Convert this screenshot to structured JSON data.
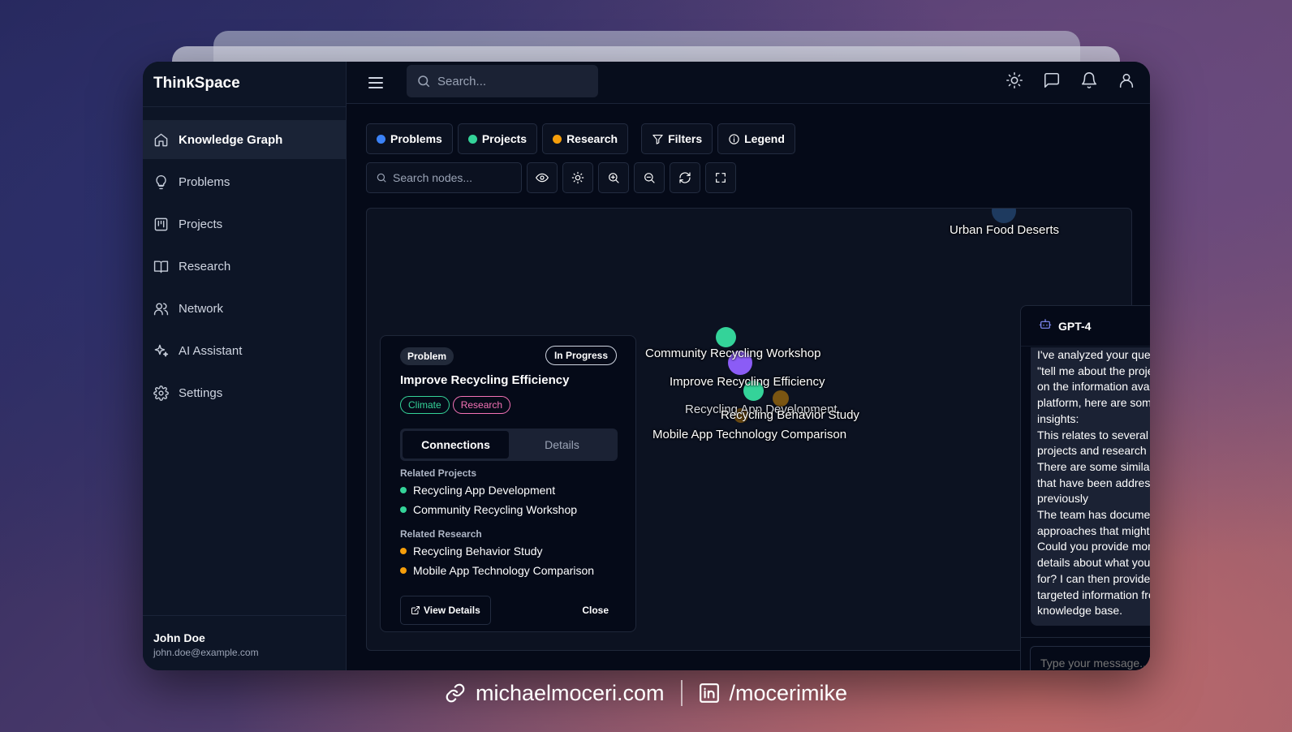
{
  "app": {
    "brand": "ThinkSpace"
  },
  "sidebar": {
    "items": [
      {
        "label": "Knowledge Graph",
        "icon": "home-icon",
        "active": true
      },
      {
        "label": "Problems",
        "icon": "lightbulb-icon"
      },
      {
        "label": "Projects",
        "icon": "project-chart-icon"
      },
      {
        "label": "Research",
        "icon": "book-open-icon"
      },
      {
        "label": "Network",
        "icon": "users-icon"
      },
      {
        "label": "AI Assistant",
        "icon": "sparkles-icon"
      },
      {
        "label": "Settings",
        "icon": "gear-icon"
      }
    ],
    "user": {
      "name": "John Doe",
      "email": "john.doe@example.com"
    }
  },
  "header": {
    "search_placeholder": "Search...",
    "icons": [
      "sun-icon",
      "message-icon",
      "bell-icon",
      "user-icon"
    ]
  },
  "filters": {
    "problems": "Problems",
    "projects": "Projects",
    "research": "Research",
    "filters": "Filters",
    "legend": "Legend"
  },
  "colors": {
    "problems": "#3b82f6",
    "projects": "#34d399",
    "research": "#f59e0b",
    "problem_node": "#8b5cf6",
    "accent": "#818cf8"
  },
  "toolbar": {
    "node_search_placeholder": "Search nodes...",
    "tools": [
      "eye-icon",
      "sun-icon",
      "zoom-in-icon",
      "zoom-out-icon",
      "refresh-icon",
      "fullscreen-icon"
    ]
  },
  "graph": {
    "labels": {
      "urban_food_deserts": "Urban Food Deserts",
      "community_recycling_workshop": "Community Recycling Workshop",
      "improve_recycling_efficiency": "Improve Recycling Efficiency",
      "recycling_app_development": "Recycling App Development",
      "recycling_behavior_study": "Recycling Behavior Study",
      "mobile_app_technology_comparison": "Mobile App Technology Comparison"
    }
  },
  "detail": {
    "type": "Problem",
    "status": "In Progress",
    "title": "Improve Recycling Efficiency",
    "tags": [
      "Climate",
      "Research"
    ],
    "tabs": [
      "Connections",
      "Details"
    ],
    "related_projects_label": "Related Projects",
    "related_projects": [
      "Recycling App Development",
      "Community Recycling Workshop"
    ],
    "related_research_label": "Related Research",
    "related_research": [
      "Recycling Behavior Study",
      "Mobile App Technology Comparison"
    ],
    "view_details": "View Details",
    "close": "Close"
  },
  "chat": {
    "title": "GPT-4",
    "message_lines": [
      "I've analyzed your question about \"tell me about the project...\". Based on the information available in our platform, here are some relevant insights:",
      "This relates to several ongoing projects and research initiatives",
      "There are some similar problems that have been addressed previously",
      "The team has documented some approaches that might be helpful",
      "Could you provide more specific details about what you're looking for? I can then provide more targeted information from our knowledge base."
    ],
    "input_placeholder": "Type your message..."
  },
  "credit": {
    "site": "michaelmoceri.com",
    "linkedin": "/mocerimike"
  }
}
